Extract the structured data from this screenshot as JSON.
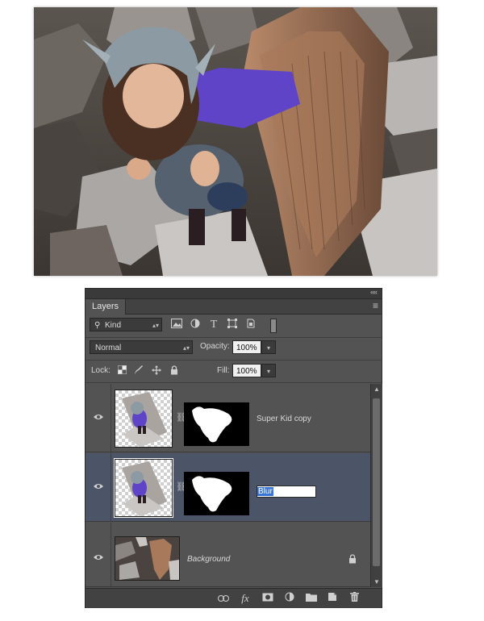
{
  "panel": {
    "tab_title": "Layers",
    "collapse_label": "««",
    "close_label": "×",
    "menu_label": "≡"
  },
  "filter": {
    "kind_label": "Kind"
  },
  "blend": {
    "mode": "Normal",
    "opacity_label": "Opacity:",
    "opacity_value": "100%",
    "lock_label": "Lock:",
    "fill_label": "Fill:",
    "fill_value": "100%"
  },
  "layers": [
    {
      "name": "Super Kid copy",
      "selected": false,
      "visible": true,
      "has_mask": true
    },
    {
      "name": "Blur",
      "selected": true,
      "visible": true,
      "has_mask": true,
      "editing": true
    },
    {
      "name": "Background",
      "selected": false,
      "visible": true,
      "locked": true
    }
  ],
  "bottom_icons": [
    "link-icon",
    "fx-icon",
    "add-mask-icon",
    "adjustment-layer-icon",
    "new-group-icon",
    "new-layer-icon",
    "trash-icon"
  ],
  "bottom_labels": {
    "fx": "fx"
  },
  "colors": {
    "panel_bg": "#535353",
    "selected_row": "#4c5567",
    "highlight": "#3874d8"
  }
}
